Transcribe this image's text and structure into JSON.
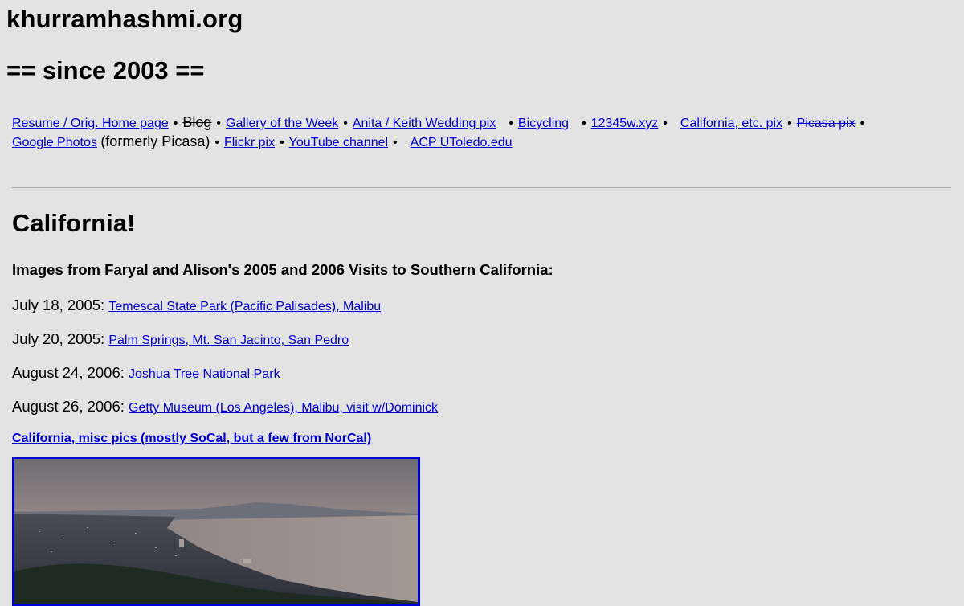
{
  "site": {
    "title": "khurramhashmi.org",
    "since": "== since 2003 =="
  },
  "nav": {
    "items": [
      {
        "label": "Resume / Orig. Home page",
        "kind": "link"
      },
      {
        "label": "Blog",
        "kind": "strike-text"
      },
      {
        "label": "Gallery of the Week",
        "kind": "link"
      },
      {
        "label": "Anita / Keith Wedding pix",
        "kind": "link"
      },
      {
        "label": "Bicycling",
        "kind": "link"
      },
      {
        "label": "12345w.xyz",
        "kind": "link"
      },
      {
        "label": "California, etc. pix",
        "kind": "link"
      },
      {
        "label": "Picasa pix",
        "kind": "strike-link"
      },
      {
        "label": "Google Photos",
        "kind": "link"
      },
      {
        "note": "(formerly Picasa)"
      },
      {
        "label": "Flickr pix",
        "kind": "link"
      },
      {
        "label": "YouTube channel",
        "kind": "link"
      },
      {
        "label": "ACP UToledo.edu",
        "kind": "link"
      }
    ],
    "separator": "•"
  },
  "main": {
    "heading": "California!",
    "subheading": "Images from Faryal and Alison's 2005 and 2006 Visits to Southern California:",
    "visits": [
      {
        "date": "July 18, 2005:",
        "link": "Temescal State Park (Pacific Palisades), Malibu"
      },
      {
        "date": "July 20, 2005:",
        "link": "Palm Springs, Mt. San Jacinto, San Pedro"
      },
      {
        "date": "August 24, 2006:",
        "link": "Joshua Tree National Park"
      },
      {
        "date": "August 26, 2006:",
        "link": "Getty Museum (Los Angeles), Malibu, visit w/Dominick"
      }
    ],
    "misc_link": "California, misc pics (mostly SoCal, but a few from NorCal)"
  },
  "colors": {
    "background": "#e3e3e3",
    "link": "#0000cc",
    "photo_border": "#0000dd"
  }
}
